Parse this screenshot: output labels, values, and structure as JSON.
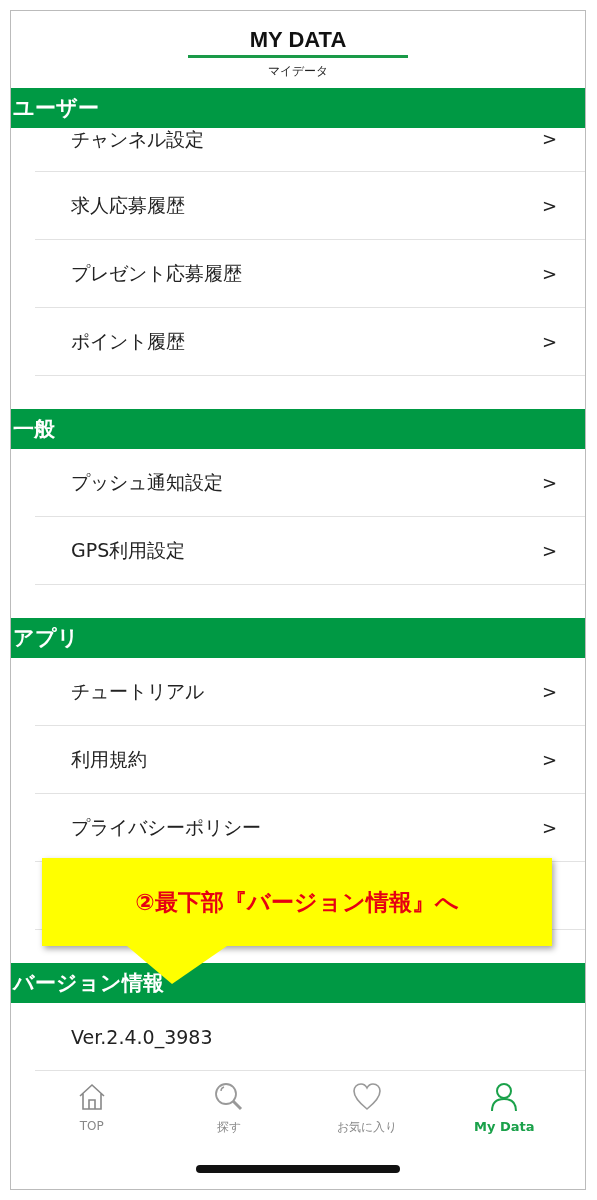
{
  "header": {
    "title": "MY DATA",
    "subtitle": "マイデータ"
  },
  "sections": [
    {
      "title": "ユーザー",
      "items": [
        {
          "label": "チャンネル設定",
          "chevron": ">"
        },
        {
          "label": "求人応募履歴",
          "chevron": ">"
        },
        {
          "label": "プレゼント応募履歴",
          "chevron": ">"
        },
        {
          "label": "ポイント履歴",
          "chevron": ">"
        }
      ]
    },
    {
      "title": "一般",
      "items": [
        {
          "label": "プッシュ通知設定",
          "chevron": ">"
        },
        {
          "label": "GPS利用設定",
          "chevron": ">"
        }
      ]
    },
    {
      "title": "アプリ",
      "items": [
        {
          "label": "チュートリアル",
          "chevron": ">"
        },
        {
          "label": "利用規約",
          "chevron": ">"
        },
        {
          "label": "プライバシーポリシー",
          "chevron": ">"
        }
      ]
    },
    {
      "title": "バージョン情報",
      "items": [
        {
          "label": "Ver.2.4.0_3983"
        }
      ]
    }
  ],
  "callout": {
    "text": "②最下部『バージョン情報』へ"
  },
  "tabs": [
    {
      "label": "TOP",
      "selected": false
    },
    {
      "label": "探す",
      "selected": false
    },
    {
      "label": "お気に入り",
      "selected": false
    },
    {
      "label": "My Data",
      "selected": true
    }
  ]
}
